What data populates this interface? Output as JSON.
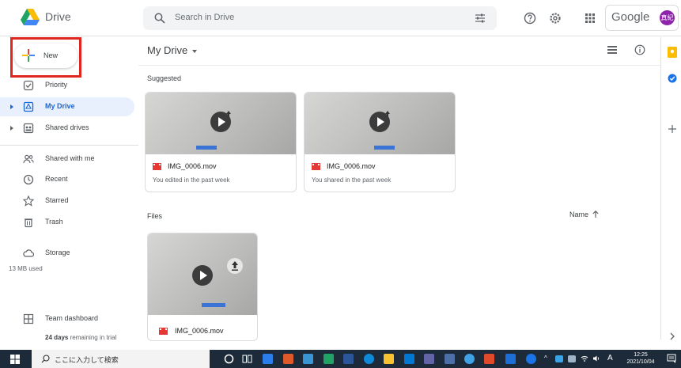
{
  "app": {
    "name": "Drive"
  },
  "header": {
    "search_placeholder": "Search in Drive",
    "brand": "Google",
    "avatar_text": "真紀"
  },
  "sidebar": {
    "new_label": "New",
    "items": [
      {
        "label": "Priority",
        "icon": "priority-icon"
      },
      {
        "label": "My Drive",
        "icon": "my-drive-icon",
        "active": true
      },
      {
        "label": "Shared drives",
        "icon": "shared-drives-icon"
      },
      {
        "label": "Shared with me",
        "icon": "shared-with-me-icon"
      },
      {
        "label": "Recent",
        "icon": "recent-icon"
      },
      {
        "label": "Starred",
        "icon": "star-icon"
      },
      {
        "label": "Trash",
        "icon": "trash-icon"
      },
      {
        "label": "Storage",
        "icon": "cloud-icon"
      }
    ],
    "storage_used": "13 MB used",
    "team_dashboard": "Team dashboard",
    "trial_days": "24 days",
    "trial_rest": "remaining in trial"
  },
  "main": {
    "title": "My Drive",
    "suggested_label": "Suggested",
    "files_label": "Files",
    "sort_label": "Name",
    "suggested": [
      {
        "name": "IMG_0006.mov",
        "sub": "You edited in the past week"
      },
      {
        "name": "IMG_0006.mov",
        "sub": "You shared in the past week"
      }
    ],
    "files": [
      {
        "name": "IMG_0006.mov"
      }
    ]
  },
  "taskbar": {
    "search_text": "ここに入力して検索",
    "time": "12:25",
    "date": "2021/10/04",
    "ime": "A"
  },
  "colors": {
    "accent": "#1967d2",
    "highlight": "#e0261f",
    "taskbar": "#1c2a39"
  }
}
